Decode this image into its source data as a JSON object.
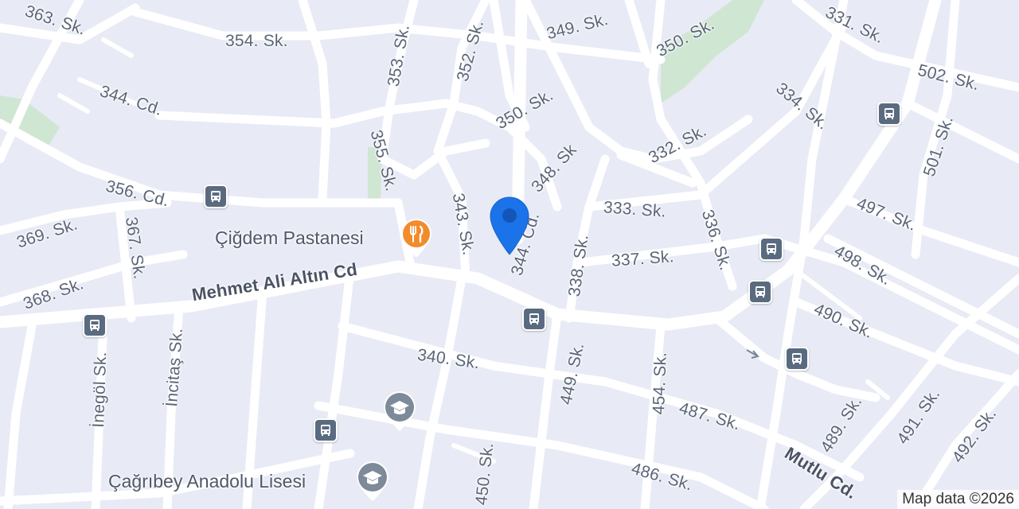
{
  "streets": {
    "s363": "363. Sk.",
    "s354": "354. Sk.",
    "s353": "353. Sk.",
    "s352": "352. Sk.",
    "s349": "349. Sk.",
    "s350a": "350. Sk.",
    "s331": "331. Sk.",
    "s502": "502. Sk.",
    "c344": "344. Cd.",
    "s350b": "350. Sk.",
    "s334": "334. Sk.",
    "s355": "355. Sk.",
    "s348": "348. Sk",
    "s332": "332. Sk.",
    "s501": "501. Sk.",
    "c356": "356. Cd.",
    "s343": "343. Sk.",
    "s333": "333. Sk.",
    "s336": "336. Sk.",
    "s497": "497. Sk.",
    "s369": "369. Sk.",
    "s367": "367. Sk.",
    "c344b": "344. Cd.",
    "s338": "338. Sk.",
    "s337": "337. Sk.",
    "s498": "498. Sk.",
    "s368": "368. Sk.",
    "main_cd": "Mehmet Ali Altın Cd",
    "s490": "490. Sk.",
    "s340": "340. Sk.",
    "s449": "449. Sk.",
    "s454": "454. Sk.",
    "inegol": "İnegöl Sk.",
    "incitas": "İncitaş Sk.",
    "s487": "487. Sk.",
    "s489": "489. Sk.",
    "s491": "491. Sk.",
    "s492": "492. Sk.",
    "mutlu": "Mutlu Cd.",
    "s450": "450. Sk.",
    "s486": "486. Sk."
  },
  "pois": {
    "pastane": "Çiğdem Pastanesi",
    "lise": "Çağrıbey Anadolu Lisesi"
  },
  "attribution": "Map data ©2026",
  "colors": {
    "background": "#e8ebf5",
    "road": "#ffffff",
    "park": "#cfe6d3",
    "transit": "#5a6b80",
    "restaurant": "#f28b2c",
    "school": "#7d8a99",
    "location_pin": "#1a73e8"
  },
  "icons": {
    "bus": "bus-stop-icon",
    "restaurant": "fork-knife-icon",
    "school": "graduation-cap-icon",
    "pin": "location-pin-icon"
  }
}
